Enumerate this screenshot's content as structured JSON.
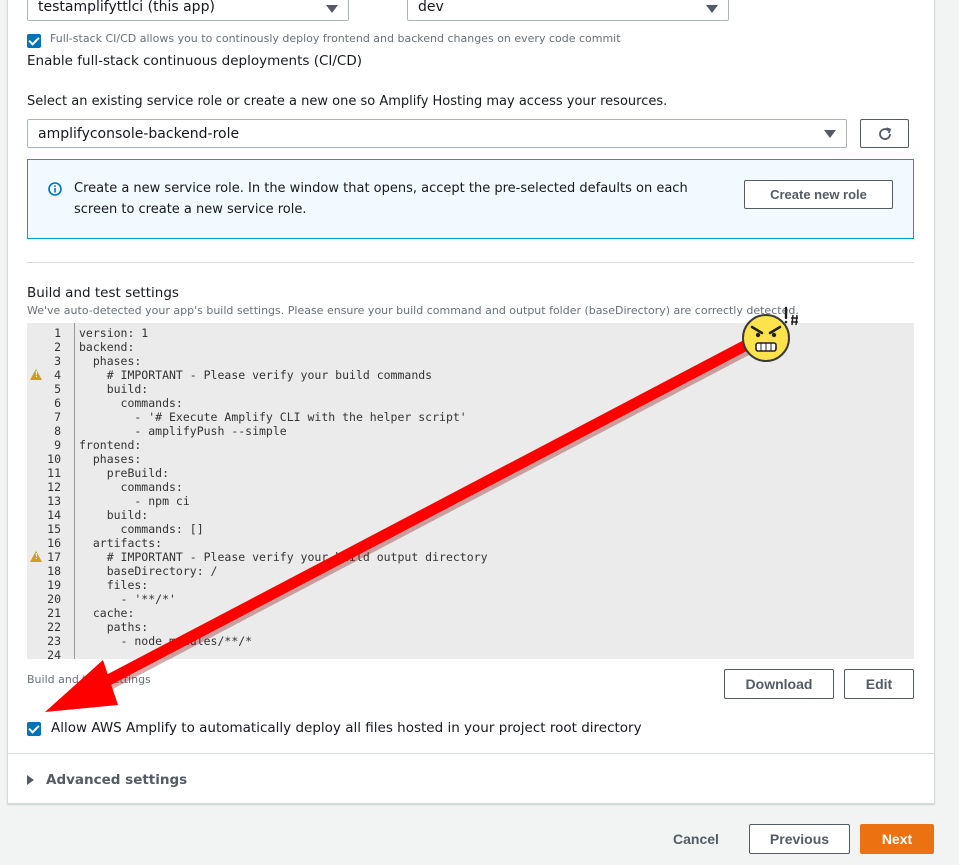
{
  "top_selects": {
    "app": "testamplifyttlci (this app)",
    "env": "dev"
  },
  "cicd": {
    "checkbox_hint": "Full-stack CI/CD allows you to continously deploy frontend and backend changes on every code commit",
    "label": "Enable full-stack continuous deployments (CI/CD)"
  },
  "service_role": {
    "label": "Select an existing service role or create a new one so Amplify Hosting may access your resources.",
    "selected": "amplifyconsole-backend-role",
    "info_line1": "Create a new service role. In the window that opens, accept the pre-selected defaults on each",
    "info_line2": "screen to create a new service role.",
    "create_button": "Create new role"
  },
  "build": {
    "title": "Build and test settings",
    "subtitle": "We've auto-detected your app's build settings. Please ensure your build command and output folder (baseDirectory) are correctly detected.",
    "footer_label": "Build and test settings",
    "download_button": "Download",
    "edit_button": "Edit",
    "lines": [
      {
        "n": "1",
        "text": "version: 1",
        "warn": false
      },
      {
        "n": "2",
        "text": "backend:",
        "warn": false
      },
      {
        "n": "3",
        "text": "  phases:",
        "warn": false
      },
      {
        "n": "4",
        "text": "    # IMPORTANT - Please verify your build commands",
        "warn": true
      },
      {
        "n": "5",
        "text": "    build:",
        "warn": false
      },
      {
        "n": "6",
        "text": "      commands:",
        "warn": false
      },
      {
        "n": "7",
        "text": "        - '# Execute Amplify CLI with the helper script'",
        "warn": false
      },
      {
        "n": "8",
        "text": "        - amplifyPush --simple",
        "warn": false
      },
      {
        "n": "9",
        "text": "frontend:",
        "warn": false
      },
      {
        "n": "10",
        "text": "  phases:",
        "warn": false
      },
      {
        "n": "11",
        "text": "    preBuild:",
        "warn": false
      },
      {
        "n": "12",
        "text": "      commands:",
        "warn": false
      },
      {
        "n": "13",
        "text": "        - npm ci",
        "warn": false
      },
      {
        "n": "14",
        "text": "    build:",
        "warn": false
      },
      {
        "n": "15",
        "text": "      commands: []",
        "warn": false
      },
      {
        "n": "16",
        "text": "  artifacts:",
        "warn": false
      },
      {
        "n": "17",
        "text": "    # IMPORTANT - Please verify your build output directory",
        "warn": true
      },
      {
        "n": "18",
        "text": "    baseDirectory: /",
        "warn": false
      },
      {
        "n": "19",
        "text": "    files:",
        "warn": false
      },
      {
        "n": "20",
        "text": "      - '**/*'",
        "warn": false
      },
      {
        "n": "21",
        "text": "  cache:",
        "warn": false
      },
      {
        "n": "22",
        "text": "    paths:",
        "warn": false
      },
      {
        "n": "23",
        "text": "      - node_modules/**/*",
        "warn": false
      },
      {
        "n": "24",
        "text": "",
        "warn": false
      }
    ]
  },
  "auto_deploy": {
    "label": "Allow AWS Amplify to automatically deploy all files hosted in your project root directory"
  },
  "advanced": {
    "label": "Advanced settings"
  },
  "footer": {
    "cancel": "Cancel",
    "previous": "Previous",
    "next": "Next"
  },
  "colors": {
    "primary": "#ec7211",
    "checkbox": "#0073bb",
    "info_border": "#00a1c9",
    "info_bg": "#f1faff",
    "annotation_arrow": "#ff0000",
    "emoji_face": "#ffe34d"
  }
}
